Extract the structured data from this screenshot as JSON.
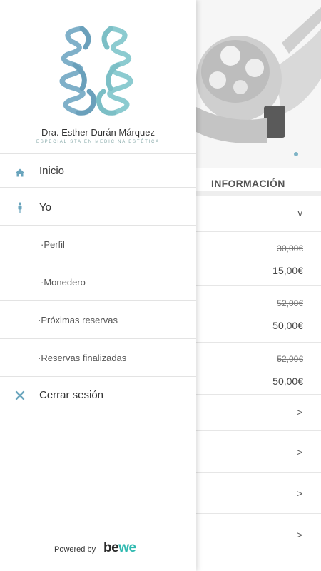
{
  "background": {
    "section_title": "INFORMACIÓN",
    "rows": [
      {
        "type": "collapse",
        "chevron": "v"
      },
      {
        "type": "price",
        "old": "30,00€",
        "new": "15,00€"
      },
      {
        "type": "price",
        "old": "52,00€",
        "new": "50,00€"
      },
      {
        "type": "price",
        "old": "52,00€",
        "new": "50,00€"
      },
      {
        "type": "link",
        "chevron": ">"
      },
      {
        "type": "link",
        "chevron": ">"
      },
      {
        "type": "link",
        "chevron": ">"
      },
      {
        "type": "link",
        "chevron": ">"
      }
    ]
  },
  "drawer": {
    "doctor_name": "Dra. Esther Durán Márquez",
    "doctor_subtitle": "ESPECIALISTA EN MEDICINA ESTÉTICA",
    "menu": {
      "home": {
        "label": "Inicio",
        "icon": "home-icon"
      },
      "me": {
        "label": "Yo",
        "icon": "person-icon"
      },
      "profile": {
        "label": "·Perfil"
      },
      "wallet": {
        "label": "·Monedero"
      },
      "upcoming": {
        "label": "·Próximas reservas"
      },
      "finished": {
        "label": "·Reservas finalizadas"
      },
      "logout": {
        "label": "Cerrar sesión",
        "icon": "close-icon"
      }
    },
    "powered_by": "Powered by",
    "brand": {
      "part1": "be",
      "part2": "we"
    }
  },
  "colors": {
    "accent": "#6aa5bd",
    "logo_blue": "#7fb0c9",
    "logo_teal": "#8ccbd0"
  }
}
